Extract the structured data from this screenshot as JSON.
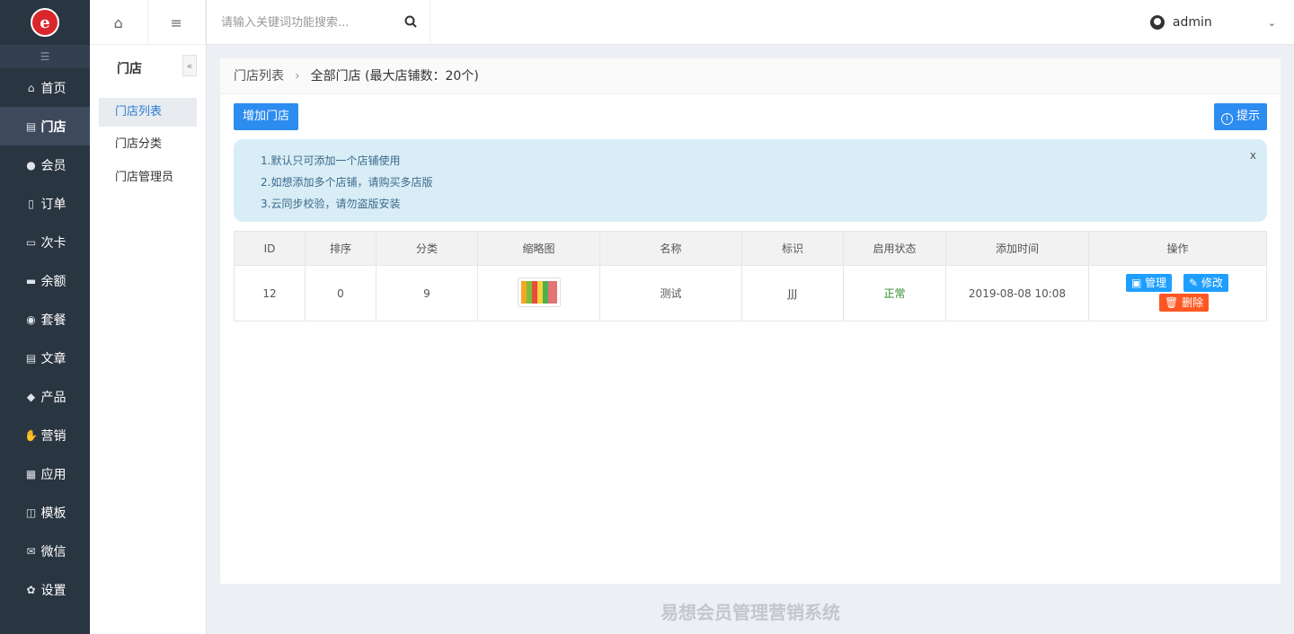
{
  "nav": {
    "logo_letter": "e",
    "collapse_icon": "list-indent-icon",
    "items": [
      {
        "label": "首页",
        "icon": "home-icon",
        "glyph": "⌂"
      },
      {
        "label": "门店",
        "icon": "store-icon",
        "glyph": "▤"
      },
      {
        "label": "会员",
        "icon": "member-icon",
        "glyph": "●"
      },
      {
        "label": "订单",
        "icon": "order-icon",
        "glyph": "▯"
      },
      {
        "label": "次卡",
        "icon": "card-icon",
        "glyph": "▭"
      },
      {
        "label": "余额",
        "icon": "balance-icon",
        "glyph": "▬"
      },
      {
        "label": "套餐",
        "icon": "package-icon",
        "glyph": "◉"
      },
      {
        "label": "文章",
        "icon": "article-icon",
        "glyph": "▤"
      },
      {
        "label": "产品",
        "icon": "tag-icon",
        "glyph": "◆"
      },
      {
        "label": "营销",
        "icon": "thumbs-up-icon",
        "glyph": "✋"
      },
      {
        "label": "应用",
        "icon": "apps-icon",
        "glyph": "▦"
      },
      {
        "label": "模板",
        "icon": "template-icon",
        "glyph": "◫"
      },
      {
        "label": "微信",
        "icon": "wechat-icon",
        "glyph": "✉"
      },
      {
        "label": "设置",
        "icon": "settings-icon",
        "glyph": "✿"
      }
    ]
  },
  "subnav": {
    "title": "门店",
    "fold_glyph": "«",
    "items": [
      "门店列表",
      "门店分类",
      "门店管理员"
    ]
  },
  "topbar": {
    "search_placeholder": "请输入关键词功能搜索...",
    "user_name": "admin"
  },
  "breadcrumb": {
    "parent": "门店列表",
    "current": "全部门店 (最大店铺数：20个)"
  },
  "buttons": {
    "add_store": "增加门店",
    "hint": "提示"
  },
  "tip": {
    "lines": [
      "1.默认只可添加一个店铺使用",
      "2.如想添加多个店铺，请购买多店版",
      "3.云同步校验，请勿盗版安装"
    ],
    "close": "x"
  },
  "table": {
    "headers": [
      "ID",
      "排序",
      "分类",
      "缩略图",
      "名称",
      "标识",
      "启用状态",
      "添加时间",
      "操作"
    ],
    "rows": [
      {
        "id": "12",
        "sort": "0",
        "category": "9",
        "name": "测试",
        "code": "JJJ",
        "status": "正常",
        "added": "2019-08-08 10:08"
      }
    ],
    "ops": {
      "manage": "管理",
      "edit": "修改",
      "delete": "删除"
    }
  },
  "footer": "易想会员管理营销系统",
  "colors": {
    "nav_bg": "#2a3542",
    "primary": "#2d8cf0",
    "danger": "#ff5722",
    "tip_bg": "#d9edf7"
  }
}
